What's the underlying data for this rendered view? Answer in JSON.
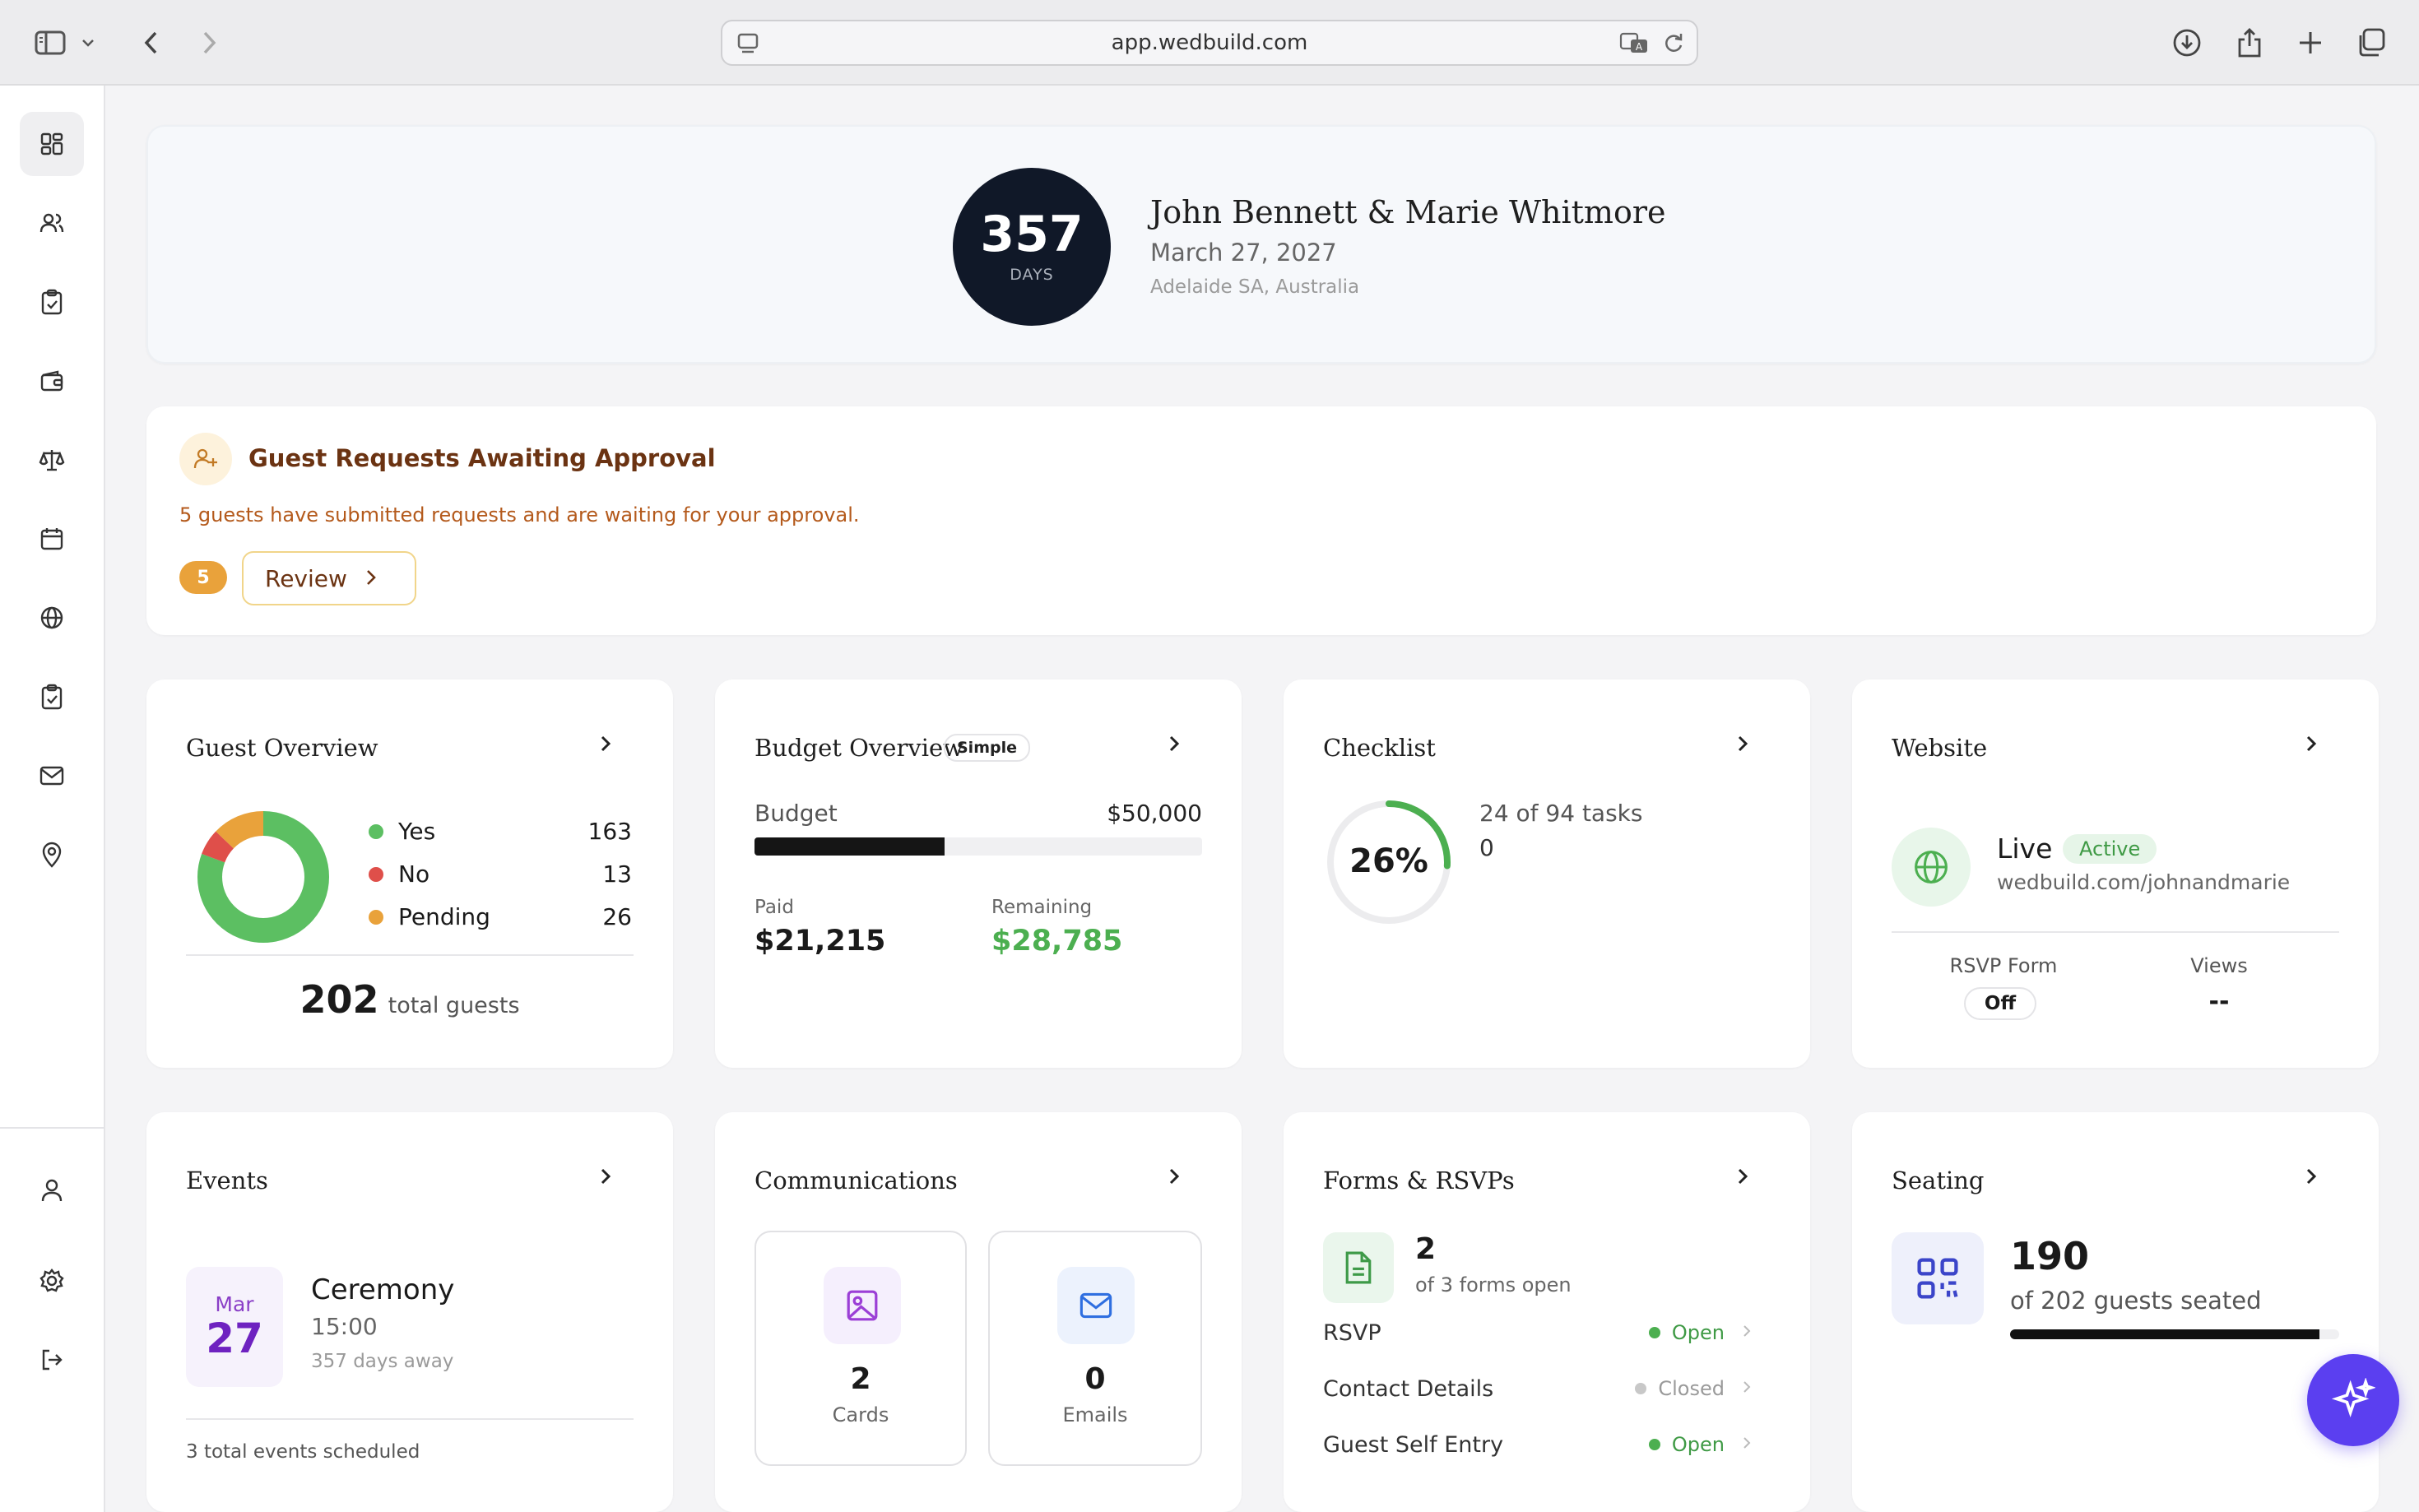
{
  "browser": {
    "url": "app.wedbuild.com"
  },
  "hero": {
    "days": "357",
    "days_label": "DAYS",
    "couple": "John Bennett & Marie Whitmore",
    "date": "March 27, 2027",
    "location": "Adelaide SA, Australia"
  },
  "requests": {
    "title": "Guest Requests Awaiting Approval",
    "description": "5 guests have submitted requests and are waiting for your approval.",
    "count": "5",
    "review_label": "Review"
  },
  "guest_overview": {
    "title": "Guest Overview",
    "yes_label": "Yes",
    "yes": "163",
    "no_label": "No",
    "no": "13",
    "pending_label": "Pending",
    "pending": "26",
    "total": "202",
    "total_label": "total guests",
    "colors": {
      "yes": "#5cbf62",
      "no": "#df4f4a",
      "pending": "#e9a23b"
    }
  },
  "budget": {
    "title": "Budget Overview",
    "mode": "Simple",
    "budget_label": "Budget",
    "budget": "$50,000",
    "paid_label": "Paid",
    "paid": "$21,215",
    "remaining_label": "Remaining",
    "remaining": "$28,785",
    "paid_fraction": 0.424
  },
  "checklist": {
    "title": "Checklist",
    "percent": "26%",
    "tasks": "24 of 94 tasks",
    "extra": "0",
    "fraction": 0.26
  },
  "website": {
    "title": "Website",
    "status": "Live",
    "badge": "Active",
    "url": "wedbuild.com/johnandmarie",
    "rsvp_label": "RSVP Form",
    "rsvp_value": "Off",
    "views_label": "Views",
    "views_value": "--"
  },
  "events": {
    "title": "Events",
    "month": "Mar",
    "day": "27",
    "name": "Ceremony",
    "time": "15:00",
    "away": "357 days away",
    "footer": "3 total events scheduled"
  },
  "communications": {
    "title": "Communications",
    "cards_count": "2",
    "cards_label": "Cards",
    "emails_count": "0",
    "emails_label": "Emails"
  },
  "forms": {
    "title": "Forms & RSVPs",
    "count": "2",
    "sub": "of 3 forms open",
    "items": [
      {
        "name": "RSVP",
        "status": "Open",
        "color": "#4caf50"
      },
      {
        "name": "Contact Details",
        "status": "Closed",
        "color": "#bdbdbd"
      },
      {
        "name": "Guest Self Entry",
        "status": "Open",
        "color": "#4caf50"
      }
    ]
  },
  "seating": {
    "title": "Seating",
    "count": "190",
    "sub": "of 202 guests seated",
    "fraction": 0.94
  }
}
